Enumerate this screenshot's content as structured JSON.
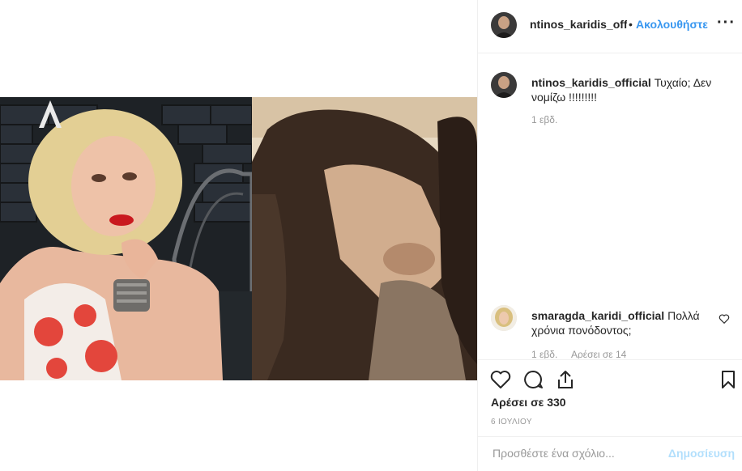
{
  "post": {
    "username": "ntinos_karidis_official",
    "header_username": "ntinos_karidis_off",
    "separator": "•",
    "follow_label": "Ακολουθήστε",
    "more_label": "···",
    "media_badge": "A"
  },
  "comments": [
    {
      "username": "ntinos_karidis_official",
      "text": "Τυχαίο; Δεν νομίζω !!!!!!!!!",
      "time": "1 εβδ.",
      "likes": ""
    },
    {
      "username": "smaragda_karidi_official",
      "text": "Πολλά χρόνια πονόδοντος;",
      "time": "1 εβδ.",
      "likes": "Αρέσει σε 14"
    }
  ],
  "actions": {
    "like_icon": "heart-icon",
    "comment_icon": "comment-icon",
    "share_icon": "share-icon",
    "save_icon": "bookmark-icon"
  },
  "likes_text": "Αρέσει σε 330",
  "date_text": "6 ΙΟΥΛΙΟΥ",
  "add_comment": {
    "placeholder": "Προσθέστε ένα σχόλιο...",
    "post_label": "Δημοσίευση"
  },
  "colors": {
    "accent": "#3897f0",
    "post_disabled": "#b2dffc",
    "border": "#efefef",
    "muted": "#999999"
  }
}
